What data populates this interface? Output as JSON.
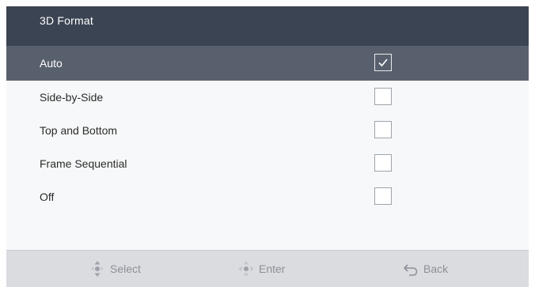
{
  "header": {
    "title": "3D Format"
  },
  "options": [
    {
      "label": "Auto",
      "checked": true
    },
    {
      "label": "Side-by-Side",
      "checked": false
    },
    {
      "label": "Top and Bottom",
      "checked": false
    },
    {
      "label": "Frame Sequential",
      "checked": false
    },
    {
      "label": "Off",
      "checked": false
    }
  ],
  "footer": {
    "select_label": "Select",
    "select_icon": "dpad-updown-icon",
    "enter_label": "Enter",
    "enter_icon": "dpad-center-icon",
    "back_label": "Back",
    "back_icon": "return-arrow-icon"
  },
  "colors": {
    "header_bg": "#3b4452",
    "selected_row_bg": "#59606d",
    "panel_bg": "#f7f8f9",
    "footer_bg": "#dadce0",
    "footer_text": "#8c9097"
  }
}
